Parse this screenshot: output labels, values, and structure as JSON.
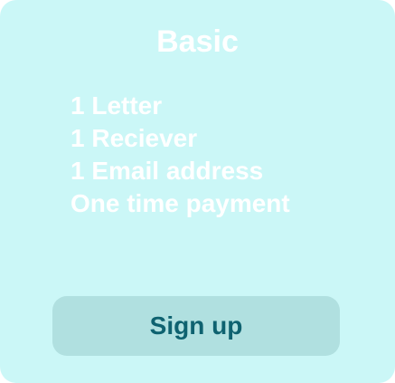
{
  "plan": {
    "title": "Basic",
    "features": [
      "1 Letter",
      "1 Reciever",
      "1 Email address",
      "One time payment"
    ],
    "signup_label": "Sign up"
  },
  "colors": {
    "card_background": "#cbf7f7",
    "text": "#ffffff",
    "button_background": "#b0e0e0",
    "button_text": "#0e6270"
  }
}
